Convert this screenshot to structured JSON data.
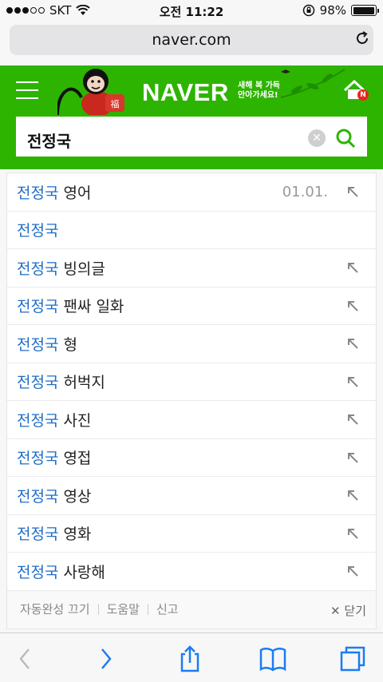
{
  "status_bar": {
    "carrier": "SKT",
    "time": "오전 11:22",
    "battery_percent": "98%",
    "battery_level": 0.98,
    "signal_bars_filled": 3,
    "signal_bars_total": 5
  },
  "browser": {
    "url": "naver.com"
  },
  "naver_header": {
    "logo": "NAVER",
    "slogan_line1": "새해 복 가득",
    "slogan_line2": "안아가세요!",
    "home_badge": "N",
    "brand_color": "#2db400"
  },
  "search": {
    "query": "전정국",
    "clear_icon": "clear-icon",
    "search_icon": "search-icon"
  },
  "suggestions": [
    {
      "highlight": "전정국",
      "rest": "영어",
      "date": "01.01."
    },
    {
      "highlight": "전정국",
      "rest": "",
      "date": ""
    },
    {
      "highlight": "전정국",
      "rest": "빙의글",
      "date": ""
    },
    {
      "highlight": "전정국",
      "rest": "팬싸 일화",
      "date": ""
    },
    {
      "highlight": "전정국",
      "rest": "형",
      "date": ""
    },
    {
      "highlight": "전정국",
      "rest": "허벅지",
      "date": ""
    },
    {
      "highlight": "전정국",
      "rest": "사진",
      "date": ""
    },
    {
      "highlight": "전정국",
      "rest": "영접",
      "date": ""
    },
    {
      "highlight": "전정국",
      "rest": "영상",
      "date": ""
    },
    {
      "highlight": "전정국",
      "rest": "영화",
      "date": ""
    },
    {
      "highlight": "전정국",
      "rest": "사랑해",
      "date": ""
    }
  ],
  "footer": {
    "autocomplete_off": "자동완성 끄기",
    "help": "도움말",
    "report": "신고",
    "close": "닫기"
  },
  "colors": {
    "highlight_blue": "#1f6cc6",
    "ios_blue": "#1a7cf5"
  }
}
